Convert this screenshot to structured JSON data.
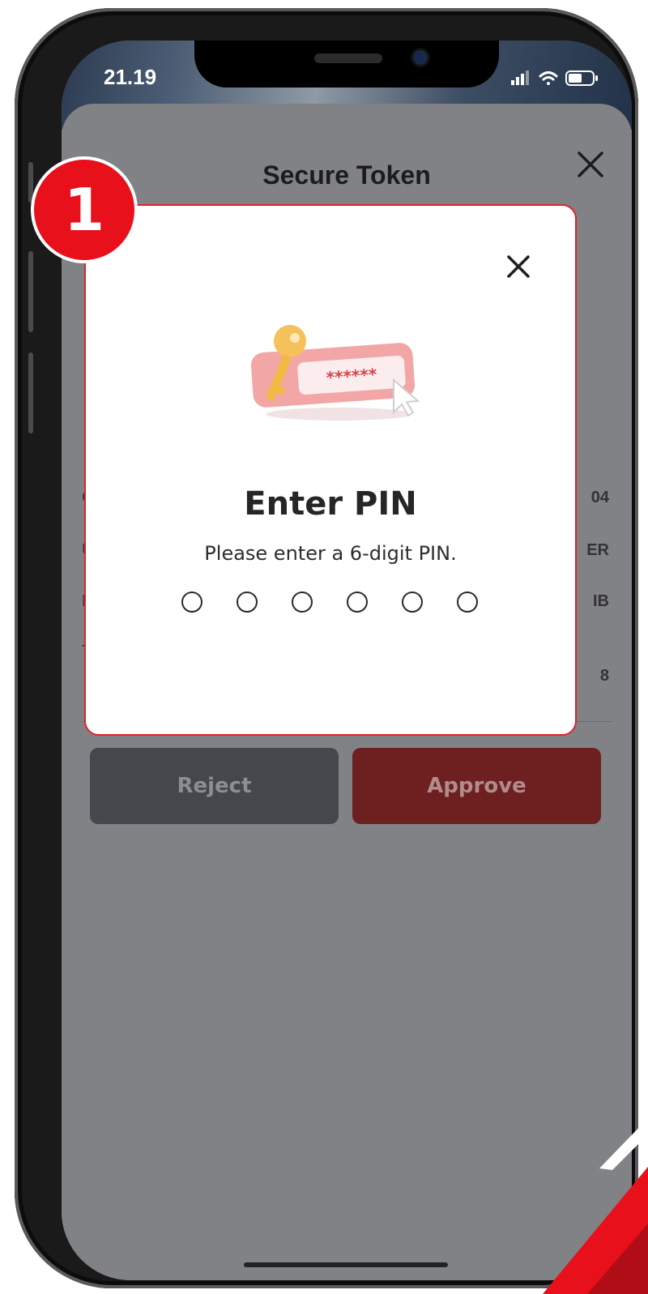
{
  "status_bar": {
    "time": "21.19"
  },
  "sheet": {
    "title": "Secure Token",
    "rows": [
      {
        "label": "Co",
        "value": "04"
      },
      {
        "label": "Us",
        "value": "ER"
      },
      {
        "label": "Da",
        "value": "IB"
      },
      {
        "label": "To",
        "value": "8"
      }
    ],
    "reject_label": "Reject",
    "approve_label": "Approve"
  },
  "modal": {
    "illustration_text": "******",
    "title": "Enter PIN",
    "subtitle": "Please enter a 6-digit PIN.",
    "pin_length": 6,
    "pin_filled": 0
  },
  "step_badge": "1",
  "icons": [
    "close-icon",
    "key-password-illustration",
    "signal-icon",
    "wifi-icon",
    "battery-icon"
  ],
  "colors": {
    "accent_red": "#e8101b",
    "approve": "#6e2020",
    "reject": "#44474b"
  }
}
